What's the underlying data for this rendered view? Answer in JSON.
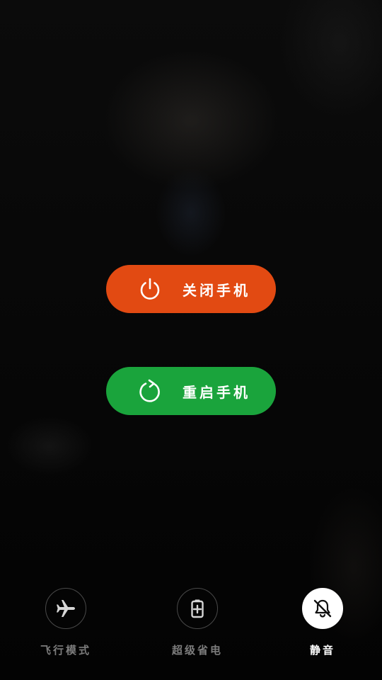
{
  "power_menu": {
    "power_off_label": "关闭手机",
    "restart_label": "重启手机"
  },
  "quick_toggles": [
    {
      "label": "飞行模式",
      "icon": "airplane-icon",
      "active": false
    },
    {
      "label": "超级省电",
      "icon": "battery-plus-icon",
      "active": false
    },
    {
      "label": "静音",
      "icon": "bell-off-icon",
      "active": true
    }
  ],
  "colors": {
    "power_off": "#e24a12",
    "restart": "#1aa43c",
    "toggle_inactive_label": "#7c7c7c",
    "toggle_active_bg": "#ffffff"
  }
}
